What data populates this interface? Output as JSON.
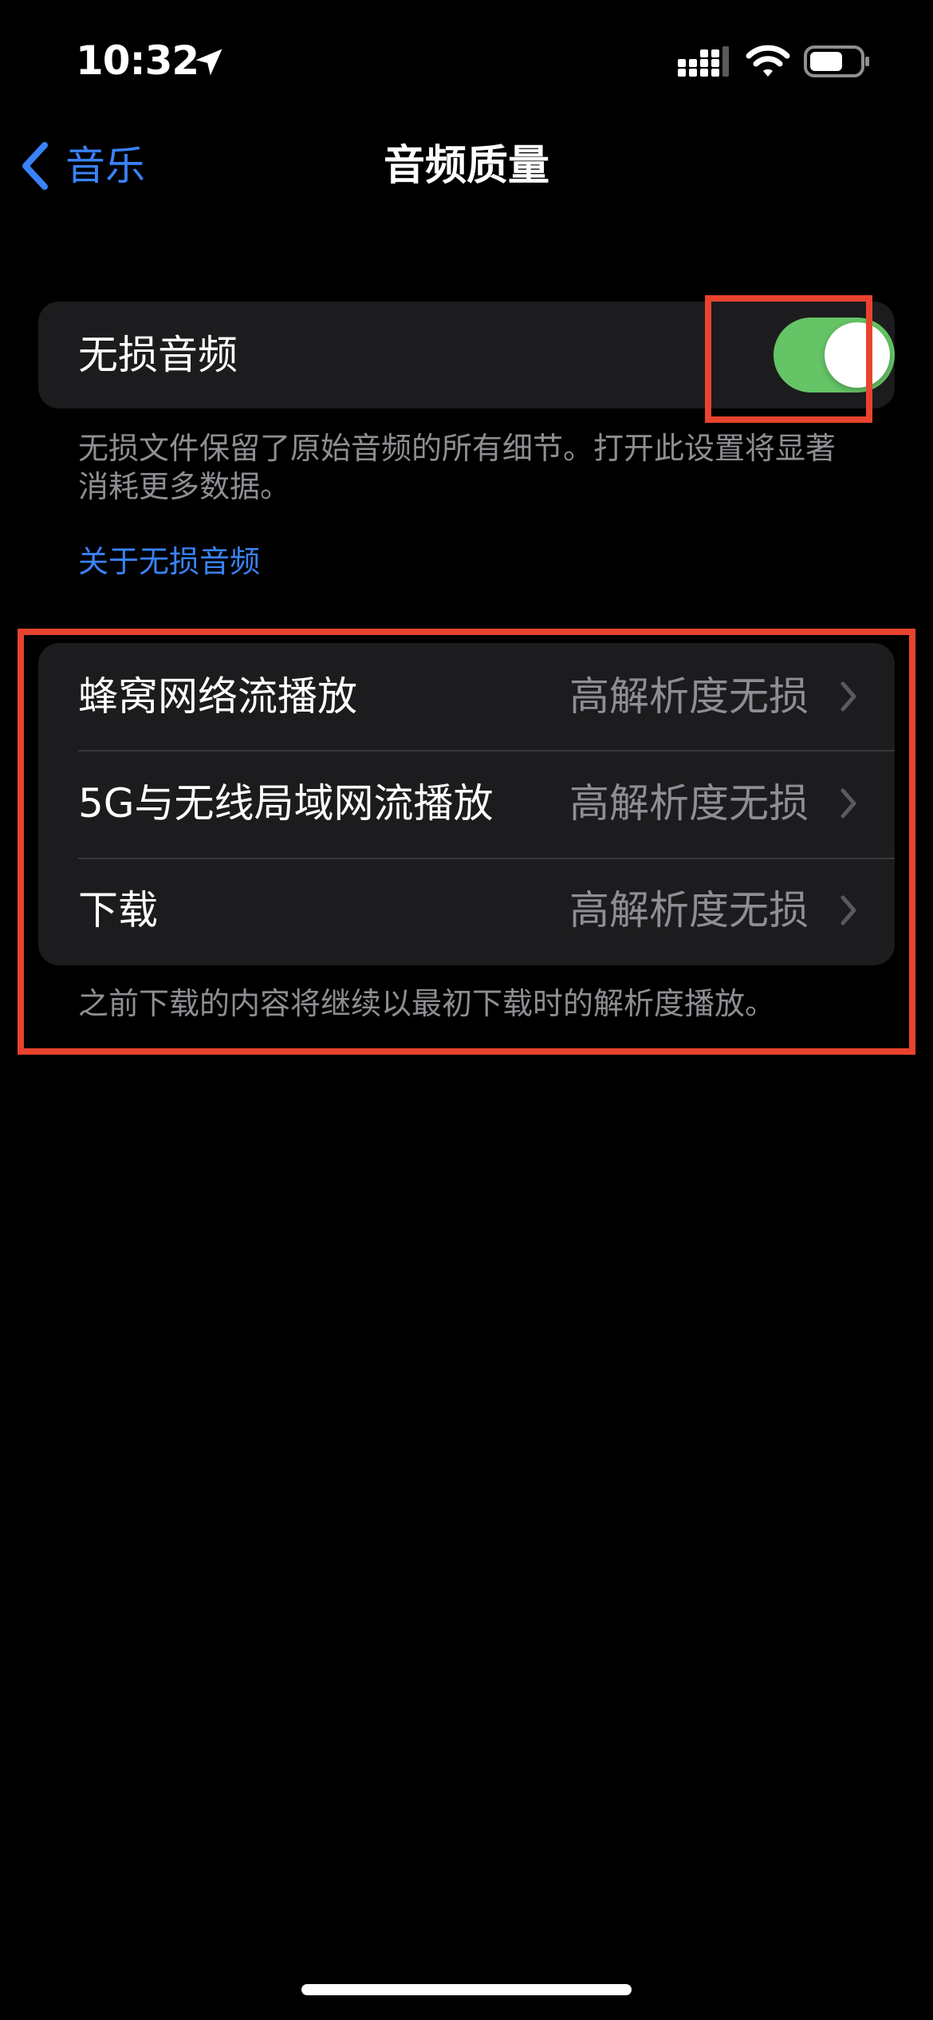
{
  "status_bar": {
    "time": "10:32",
    "icons": [
      "location-arrow-icon",
      "cellular-signal-icon",
      "wifi-icon",
      "battery-icon"
    ]
  },
  "nav": {
    "back_label": "音乐",
    "title": "音频质量"
  },
  "lossless": {
    "label": "无损音频",
    "enabled": true,
    "footer": "无损文件保留了原始音频的所有细节。打开此设置将显著消耗更多数据。",
    "link": "关于无损音频"
  },
  "quality_rows": [
    {
      "label": "蜂窝网络流播放",
      "value": "高解析度无损"
    },
    {
      "label": "5G与无线局域网流播放",
      "value": "高解析度无损"
    },
    {
      "label": "下载",
      "value": "高解析度无损"
    }
  ],
  "quality_footer": "之前下载的内容将继续以最初下载时的解析度播放。",
  "colors": {
    "accent": "#3a82f7",
    "toggle_on": "#65c466",
    "annotation": "#e8432e",
    "cell_bg": "#1c1c1e",
    "secondary_text": "#8e8e93"
  }
}
